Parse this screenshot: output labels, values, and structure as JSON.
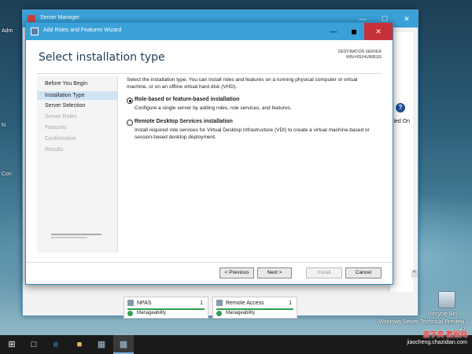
{
  "desktop": {
    "label_admin": "Adm",
    "label_n": "N",
    "label_con": "Con",
    "recycle_bin": "Recycle Bin",
    "os_name": "Windows Server Technical Preview 2",
    "build_fragment": "47"
  },
  "server_manager": {
    "title": "Server Manager",
    "right_text": "alled On",
    "tiles": [
      {
        "name": "NPAS",
        "count": "1",
        "status": "Manageability"
      },
      {
        "name": "Remote Access",
        "count": "1",
        "status": "Manageability"
      }
    ]
  },
  "wizard": {
    "title": "Add Roles and Features Wizard",
    "header": "Select installation type",
    "destination_label": "DESTINATION SERVER",
    "destination_value": "WIN-H3UHUR86JIS",
    "nav": [
      {
        "label": "Before You Begin",
        "state": "normal"
      },
      {
        "label": "Installation Type",
        "state": "active"
      },
      {
        "label": "Server Selection",
        "state": "normal"
      },
      {
        "label": "Server Roles",
        "state": "disabled"
      },
      {
        "label": "Features",
        "state": "disabled"
      },
      {
        "label": "Confirmation",
        "state": "disabled"
      },
      {
        "label": "Results",
        "state": "disabled"
      }
    ],
    "intro": "Select the installation type. You can install roles and features on a running physical computer or virtual machine, or on an offline virtual hard disk (VHD).",
    "options": [
      {
        "title": "Role-based or feature-based installation",
        "desc": "Configure a single server by adding roles, role services, and features.",
        "selected": true
      },
      {
        "title": "Remote Desktop Services installation",
        "desc": "Install required role services for Virtual Desktop Infrastructure (VDI) to create a virtual machine-based or session-based desktop deployment.",
        "selected": false
      }
    ],
    "buttons": {
      "previous": "< Previous",
      "next": "Next >",
      "install": "Install",
      "cancel": "Cancel"
    }
  },
  "watermark": {
    "line1": "查字典 教程网",
    "line2": "jiaocheng.chazidian.com"
  }
}
